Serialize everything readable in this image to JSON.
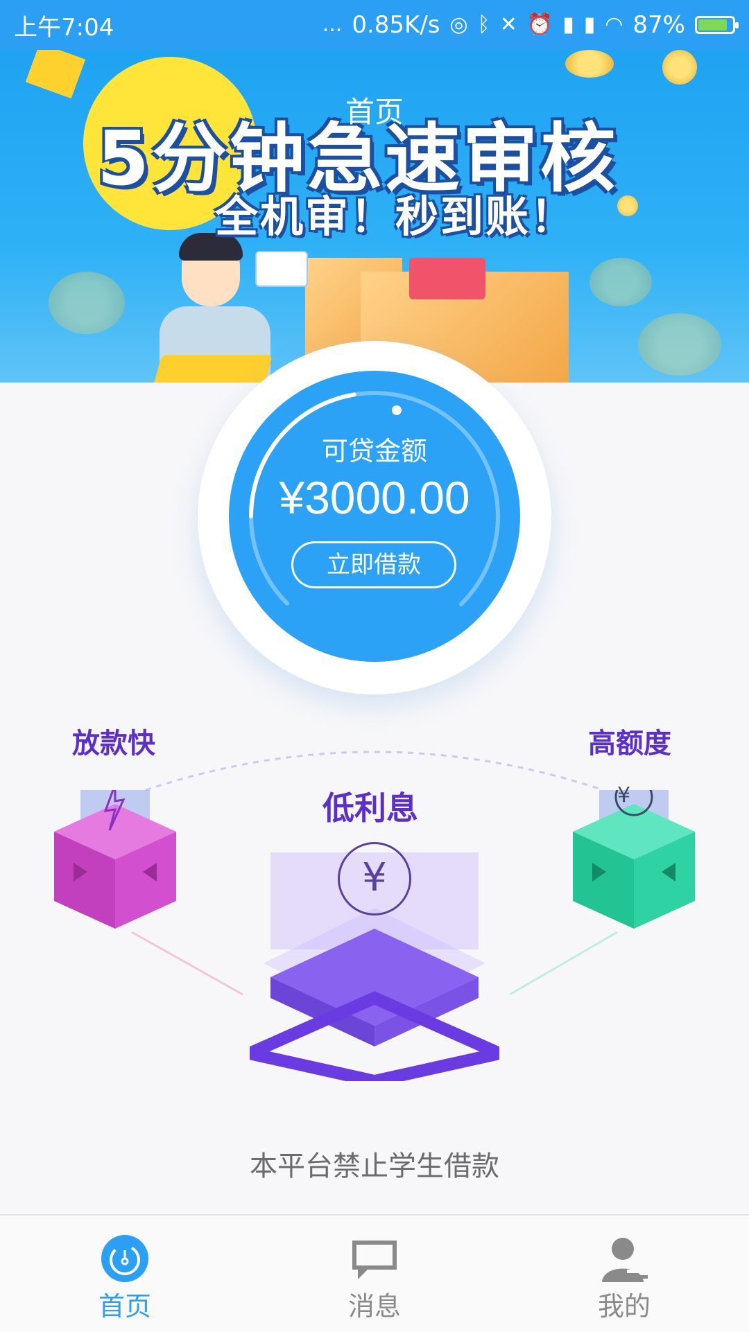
{
  "status_bar": {
    "time": "上午7:04",
    "dots": "...",
    "network_speed": "0.85K/s",
    "battery_percent": "87%",
    "battery_level": 0.87
  },
  "header": {
    "title": "首页"
  },
  "banner": {
    "headline": "5分钟急速审核",
    "subline": "全机审！秒到账！"
  },
  "loan_dial": {
    "label": "可贷金额",
    "amount": "¥3000.00",
    "button_label": "立即借款"
  },
  "features": {
    "left": "放款快",
    "center": "低利息",
    "right": "高额度",
    "yen_glyph": "¥"
  },
  "notice": "本平台禁止学生借款",
  "tabbar": {
    "tabs": [
      {
        "label": "首页",
        "icon": "home-dial-icon",
        "active": true
      },
      {
        "label": "消息",
        "icon": "chat-bubble-icon",
        "active": false
      },
      {
        "label": "我的",
        "icon": "user-profile-icon",
        "active": false
      }
    ]
  },
  "colors": {
    "primary_blue": "#2a9ff4",
    "feature_purple": "#5b2fc9",
    "pink_cube": "#c83fc2",
    "green_cube": "#2fcf9f"
  }
}
